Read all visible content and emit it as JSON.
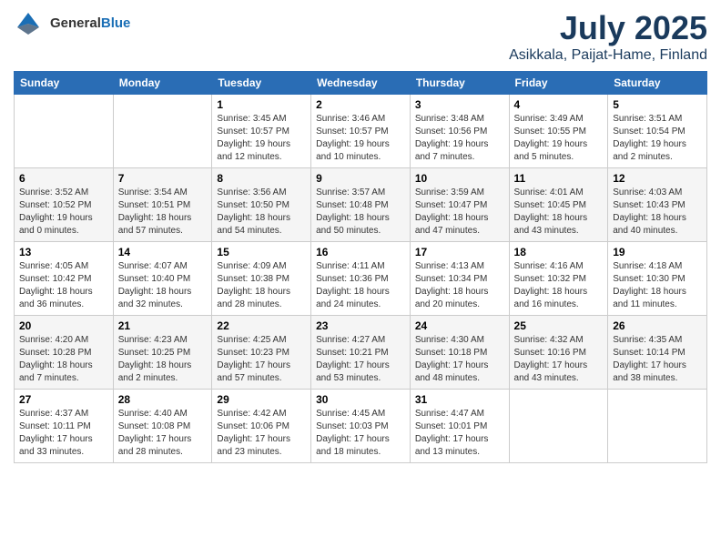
{
  "header": {
    "logo": {
      "general": "General",
      "blue": "Blue"
    },
    "title": "July 2025",
    "location": "Asikkala, Paijat-Hame, Finland"
  },
  "calendar": {
    "days_of_week": [
      "Sunday",
      "Monday",
      "Tuesday",
      "Wednesday",
      "Thursday",
      "Friday",
      "Saturday"
    ],
    "weeks": [
      [
        {
          "day": "",
          "info": ""
        },
        {
          "day": "",
          "info": ""
        },
        {
          "day": "1",
          "info": "Sunrise: 3:45 AM\nSunset: 10:57 PM\nDaylight: 19 hours\nand 12 minutes."
        },
        {
          "day": "2",
          "info": "Sunrise: 3:46 AM\nSunset: 10:57 PM\nDaylight: 19 hours\nand 10 minutes."
        },
        {
          "day": "3",
          "info": "Sunrise: 3:48 AM\nSunset: 10:56 PM\nDaylight: 19 hours\nand 7 minutes."
        },
        {
          "day": "4",
          "info": "Sunrise: 3:49 AM\nSunset: 10:55 PM\nDaylight: 19 hours\nand 5 minutes."
        },
        {
          "day": "5",
          "info": "Sunrise: 3:51 AM\nSunset: 10:54 PM\nDaylight: 19 hours\nand 2 minutes."
        }
      ],
      [
        {
          "day": "6",
          "info": "Sunrise: 3:52 AM\nSunset: 10:52 PM\nDaylight: 19 hours\nand 0 minutes."
        },
        {
          "day": "7",
          "info": "Sunrise: 3:54 AM\nSunset: 10:51 PM\nDaylight: 18 hours\nand 57 minutes."
        },
        {
          "day": "8",
          "info": "Sunrise: 3:56 AM\nSunset: 10:50 PM\nDaylight: 18 hours\nand 54 minutes."
        },
        {
          "day": "9",
          "info": "Sunrise: 3:57 AM\nSunset: 10:48 PM\nDaylight: 18 hours\nand 50 minutes."
        },
        {
          "day": "10",
          "info": "Sunrise: 3:59 AM\nSunset: 10:47 PM\nDaylight: 18 hours\nand 47 minutes."
        },
        {
          "day": "11",
          "info": "Sunrise: 4:01 AM\nSunset: 10:45 PM\nDaylight: 18 hours\nand 43 minutes."
        },
        {
          "day": "12",
          "info": "Sunrise: 4:03 AM\nSunset: 10:43 PM\nDaylight: 18 hours\nand 40 minutes."
        }
      ],
      [
        {
          "day": "13",
          "info": "Sunrise: 4:05 AM\nSunset: 10:42 PM\nDaylight: 18 hours\nand 36 minutes."
        },
        {
          "day": "14",
          "info": "Sunrise: 4:07 AM\nSunset: 10:40 PM\nDaylight: 18 hours\nand 32 minutes."
        },
        {
          "day": "15",
          "info": "Sunrise: 4:09 AM\nSunset: 10:38 PM\nDaylight: 18 hours\nand 28 minutes."
        },
        {
          "day": "16",
          "info": "Sunrise: 4:11 AM\nSunset: 10:36 PM\nDaylight: 18 hours\nand 24 minutes."
        },
        {
          "day": "17",
          "info": "Sunrise: 4:13 AM\nSunset: 10:34 PM\nDaylight: 18 hours\nand 20 minutes."
        },
        {
          "day": "18",
          "info": "Sunrise: 4:16 AM\nSunset: 10:32 PM\nDaylight: 18 hours\nand 16 minutes."
        },
        {
          "day": "19",
          "info": "Sunrise: 4:18 AM\nSunset: 10:30 PM\nDaylight: 18 hours\nand 11 minutes."
        }
      ],
      [
        {
          "day": "20",
          "info": "Sunrise: 4:20 AM\nSunset: 10:28 PM\nDaylight: 18 hours\nand 7 minutes."
        },
        {
          "day": "21",
          "info": "Sunrise: 4:23 AM\nSunset: 10:25 PM\nDaylight: 18 hours\nand 2 minutes."
        },
        {
          "day": "22",
          "info": "Sunrise: 4:25 AM\nSunset: 10:23 PM\nDaylight: 17 hours\nand 57 minutes."
        },
        {
          "day": "23",
          "info": "Sunrise: 4:27 AM\nSunset: 10:21 PM\nDaylight: 17 hours\nand 53 minutes."
        },
        {
          "day": "24",
          "info": "Sunrise: 4:30 AM\nSunset: 10:18 PM\nDaylight: 17 hours\nand 48 minutes."
        },
        {
          "day": "25",
          "info": "Sunrise: 4:32 AM\nSunset: 10:16 PM\nDaylight: 17 hours\nand 43 minutes."
        },
        {
          "day": "26",
          "info": "Sunrise: 4:35 AM\nSunset: 10:14 PM\nDaylight: 17 hours\nand 38 minutes."
        }
      ],
      [
        {
          "day": "27",
          "info": "Sunrise: 4:37 AM\nSunset: 10:11 PM\nDaylight: 17 hours\nand 33 minutes."
        },
        {
          "day": "28",
          "info": "Sunrise: 4:40 AM\nSunset: 10:08 PM\nDaylight: 17 hours\nand 28 minutes."
        },
        {
          "day": "29",
          "info": "Sunrise: 4:42 AM\nSunset: 10:06 PM\nDaylight: 17 hours\nand 23 minutes."
        },
        {
          "day": "30",
          "info": "Sunrise: 4:45 AM\nSunset: 10:03 PM\nDaylight: 17 hours\nand 18 minutes."
        },
        {
          "day": "31",
          "info": "Sunrise: 4:47 AM\nSunset: 10:01 PM\nDaylight: 17 hours\nand 13 minutes."
        },
        {
          "day": "",
          "info": ""
        },
        {
          "day": "",
          "info": ""
        }
      ]
    ]
  }
}
